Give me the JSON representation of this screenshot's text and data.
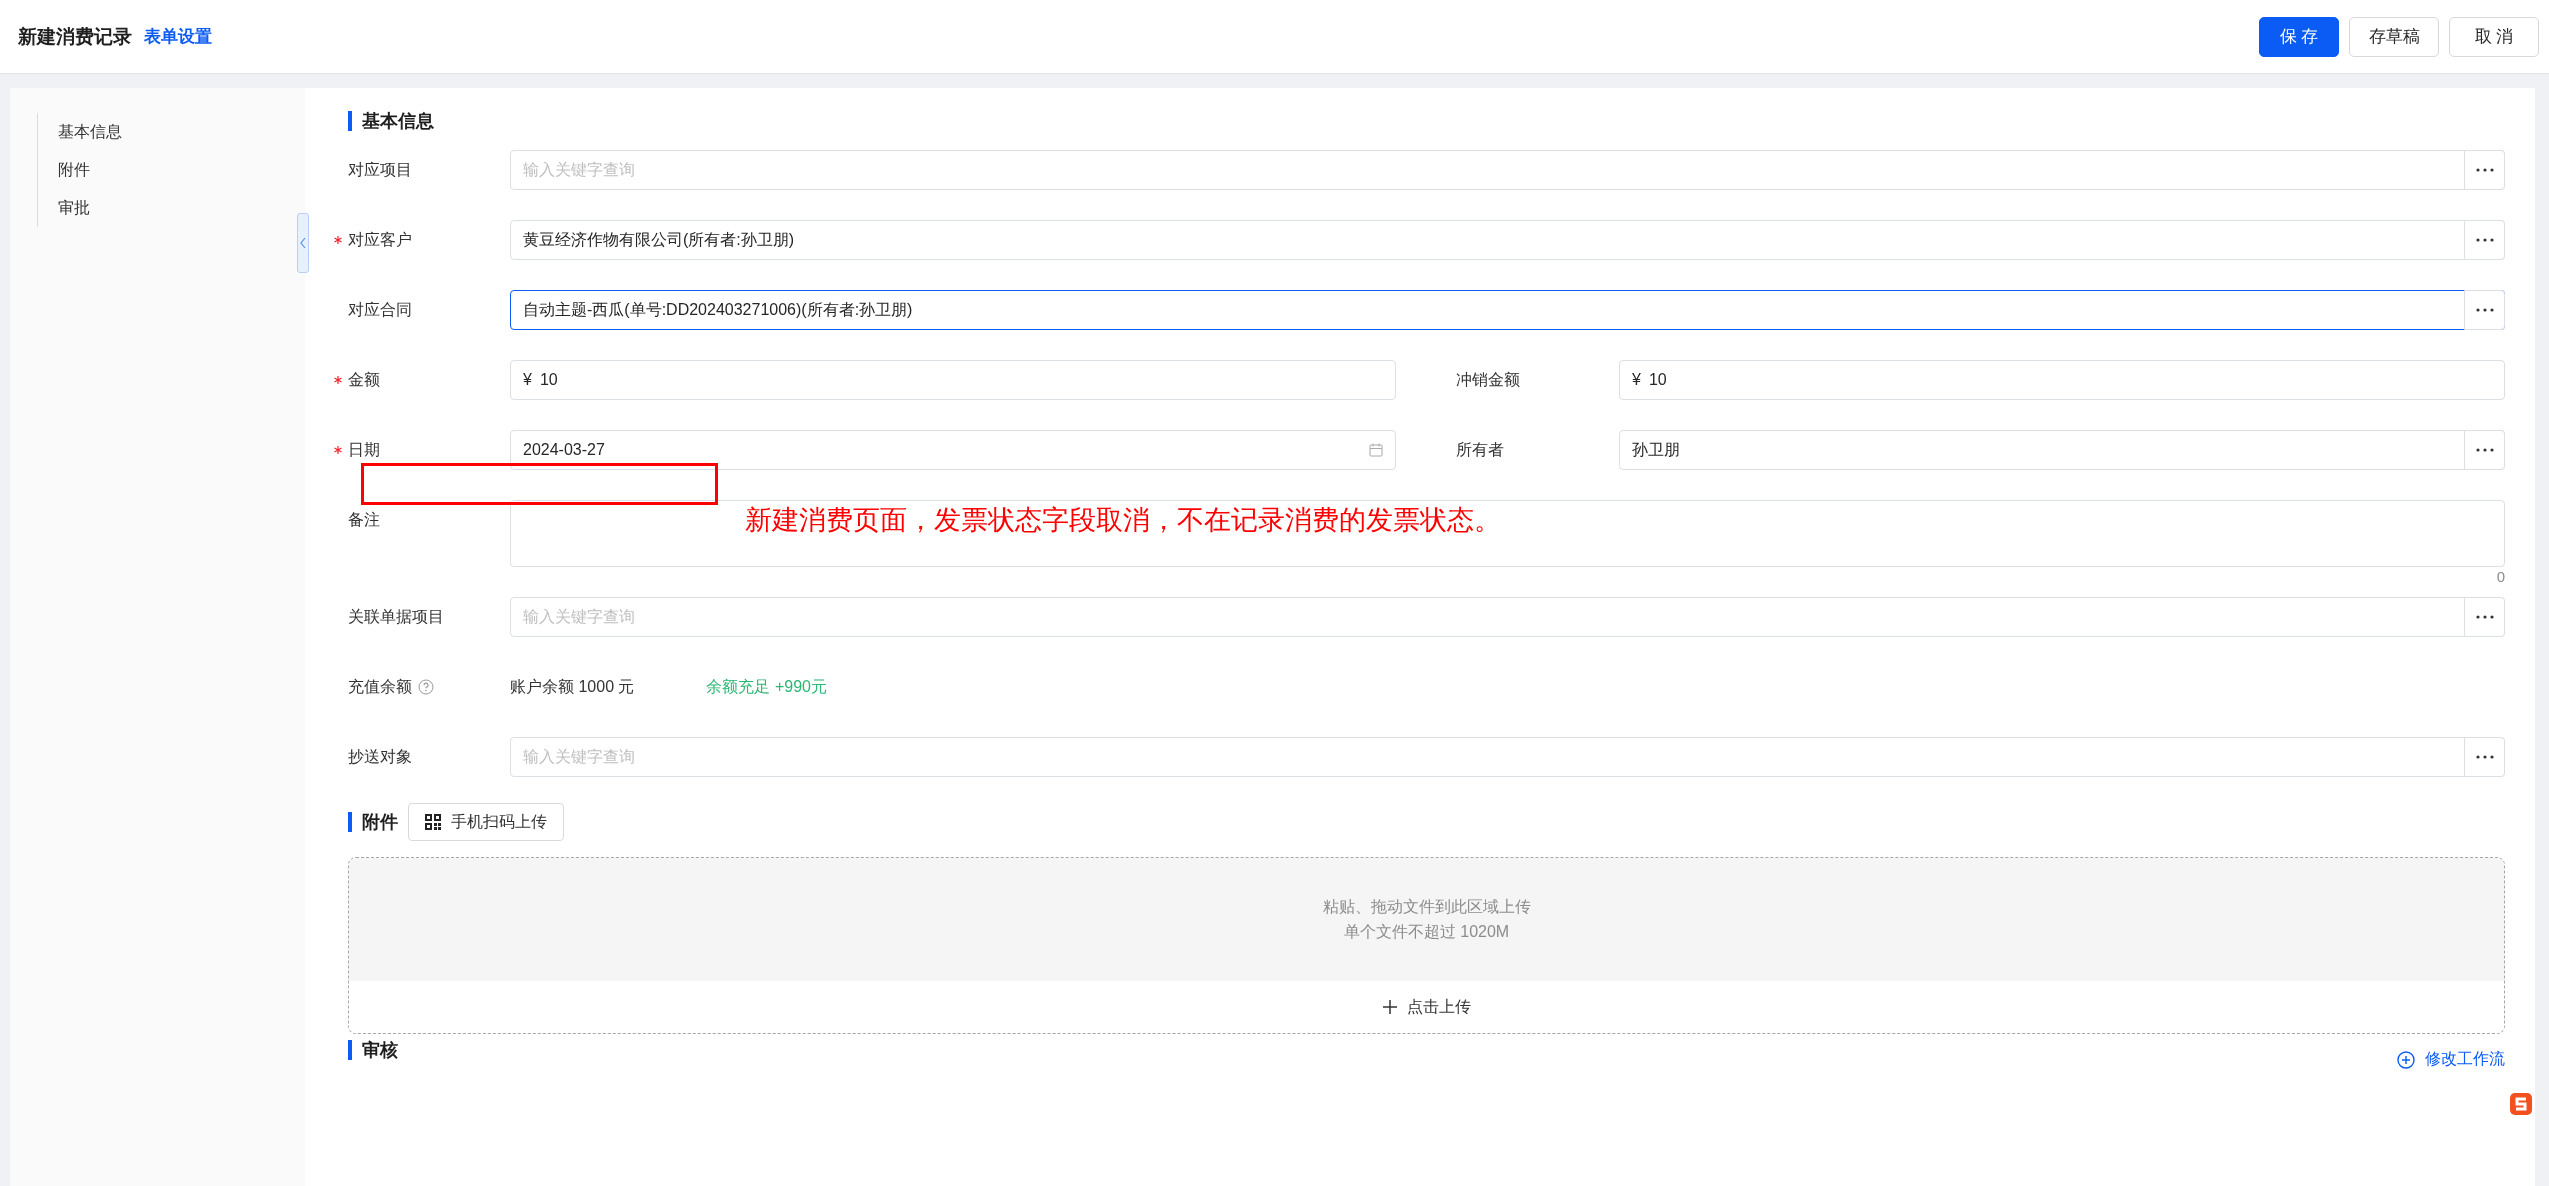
{
  "header": {
    "title": "新建消费记录",
    "settings_link": "表单设置",
    "buttons": [
      {
        "label": "保 存",
        "kind": "primary"
      },
      {
        "label": "存草稿",
        "kind": "default"
      },
      {
        "label": "取 消",
        "kind": "default"
      }
    ]
  },
  "sidebar": {
    "items": [
      {
        "label": "基本信息"
      },
      {
        "label": "附件"
      },
      {
        "label": "审批"
      }
    ]
  },
  "basic_info": {
    "title": "基本信息",
    "rows": [
      {
        "fields": [
          {
            "kind": "lookup",
            "label": "对应项目",
            "required": false,
            "focused": false,
            "placeholder": "输入关键字查询"
          }
        ]
      },
      {
        "fields": [
          {
            "kind": "lookup",
            "label": "对应客户",
            "required": true,
            "focused": false,
            "value": "黄豆经济作物有限公司(所有者:孙卫朋)"
          }
        ]
      },
      {
        "fields": [
          {
            "kind": "lookup",
            "label": "对应合同",
            "required": false,
            "focused": true,
            "value": "自动主题-西瓜(单号:DD202403271006)(所有者:孙卫朋)"
          }
        ]
      },
      {
        "fields": [
          {
            "kind": "money",
            "label": "金额",
            "required": true,
            "focused": false,
            "currency": "¥",
            "value": "10"
          },
          {
            "kind": "money",
            "label": "冲销金额",
            "required": false,
            "focused": false,
            "currency": "¥",
            "value": "10"
          }
        ]
      },
      {
        "fields": [
          {
            "kind": "date",
            "label": "日期",
            "required": true,
            "focused": false,
            "value": "2024-03-27"
          },
          {
            "kind": "lookup",
            "label": "所有者",
            "required": false,
            "focused": false,
            "value": "孙卫朋"
          }
        ]
      },
      {
        "fields": [
          {
            "kind": "textarea",
            "label": "备注",
            "required": false,
            "focused": false,
            "counter": "0"
          }
        ]
      },
      {
        "fields": [
          {
            "kind": "lookup",
            "label": "关联单据项目",
            "required": false,
            "focused": false,
            "placeholder": "输入关键字查询"
          }
        ]
      },
      {
        "fields": [
          {
            "kind": "balance",
            "label": "充值余额",
            "required": false,
            "value": "账户余额 1000 元",
            "status": "余额充足 +990元"
          }
        ]
      },
      {
        "fields": [
          {
            "kind": "lookup",
            "label": "抄送对象",
            "required": false,
            "focused": false,
            "placeholder": "输入关键字查询"
          }
        ]
      }
    ]
  },
  "attachments": {
    "title": "附件",
    "scan_button": "手机扫码上传",
    "drop_hint": "粘贴、拖动文件到此区域上传",
    "size_limit": "单个文件不超过 1020M",
    "upload_button": "点击上传"
  },
  "review": {
    "title": "审核",
    "edit_workflow": "修改工作流"
  },
  "annotation": {
    "note": "新建消费页面，发票状态字段取消，不在记录消费的发票状态。"
  }
}
